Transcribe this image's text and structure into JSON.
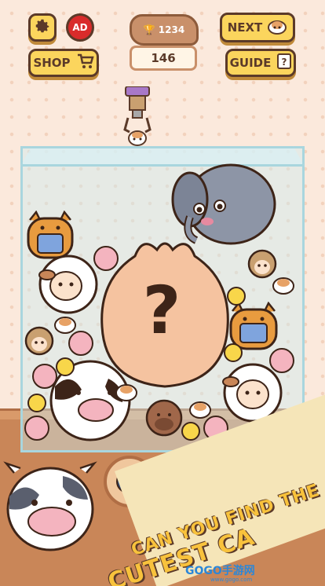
{
  "top_bar": {
    "ad_label": "AD",
    "trophy_value": "1234",
    "score_value": "146",
    "next_label": "NEXT",
    "shop_label": "SHOP",
    "guide_label": "GUIDE"
  },
  "tank": {
    "mystery_symbol": "?",
    "animals": [
      "elephant",
      "cat",
      "sheep",
      "pig",
      "hedgehog",
      "hamster",
      "chick",
      "cow",
      "capybara",
      "paw"
    ]
  },
  "bottom_bar": {
    "plus_label": "+"
  },
  "promo": {
    "line1": "CAN YOU FIND THE",
    "line2": "CUTEST CA"
  },
  "watermark": {
    "brand": "GOGO手游网",
    "url": "www.gogo.com"
  },
  "colors": {
    "button_yellow": "#fbd55d",
    "outline_brown": "#5b3a29",
    "background": "#fbe9dc"
  }
}
